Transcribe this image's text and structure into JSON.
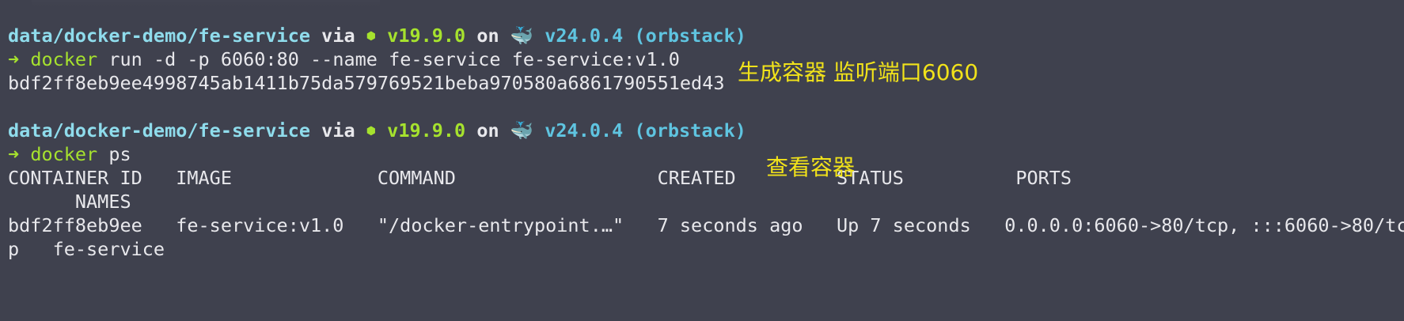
{
  "prompt": {
    "path": "data/docker-demo/fe-service",
    "via": "via",
    "node_icon": "⬢",
    "node_version": "v19.9.0",
    "on": "on",
    "docker_icon": "🐳",
    "docker_version": "v24.0.4 (orbstack)"
  },
  "arrow": "➜",
  "commands": [
    {
      "name": "docker",
      "args": "run -d -p 6060:80 --name fe-service fe-service:v1.0",
      "output": [
        "bdf2ff8eb9ee4998745ab1411b75da579769521beba970580a6861790551ed43"
      ]
    },
    {
      "name": "docker",
      "args": "ps",
      "output": [
        "CONTAINER ID   IMAGE             COMMAND                  CREATED         STATUS          PORTS",
        "      NAMES",
        "bdf2ff8eb9ee   fe-service:v1.0   \"/docker-entrypoint.…\"   7 seconds ago   Up 7 seconds   0.0.0.0:6060->80/tcp, :::6060->80/tc",
        "p   fe-service"
      ]
    }
  ],
  "annotations": {
    "create_container": "生成容器 监听端口6060",
    "view_container": "查看容器"
  },
  "colors": {
    "background": "#3f414e",
    "path": "#8fdcec",
    "green": "#a6e22e",
    "annotation": "#f1e21a"
  }
}
